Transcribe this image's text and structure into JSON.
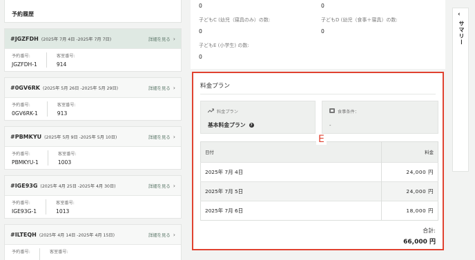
{
  "history": {
    "title": "予約履歴",
    "detail_label": "詳細を見る",
    "reservation_no_label": "予約番号:",
    "room_no_label": "客室番号:",
    "items": [
      {
        "code": "#JGZFDH",
        "dates": "(2025年 7月 4日 -2025年 7月 7日)",
        "reservation_no": "JGZFDH-1",
        "room_no": "914"
      },
      {
        "code": "#0GV6RK",
        "dates": "(2025年 5月 26日 -2025年 5月 29日)",
        "reservation_no": "0GV6RK-1",
        "room_no": "913"
      },
      {
        "code": "#PBMKYU",
        "dates": "(2025年 5月 9日 -2025年 5月 10日)",
        "reservation_no": "PBMKYU-1",
        "room_no": "1003"
      },
      {
        "code": "#IGE93G",
        "dates": "(2025年 4月 25日 -2025年 4月 30日)",
        "reservation_no": "IGE93G-1",
        "room_no": "1013"
      },
      {
        "code": "#ILTEQH",
        "dates": "(2025年 4月 14日 -2025年 4月 15日)",
        "reservation_no": "",
        "room_no": ""
      }
    ]
  },
  "counts": {
    "top_left_value": "0",
    "top_right_value": "0",
    "child_c_label": "子どもC (幼児（寝具のみ）の数:",
    "child_c_value": "0",
    "child_d_label": "子どもD (幼児（食事＋寝具）の数:",
    "child_d_value": "0",
    "child_e_label": "子どもE (小学生) の数:",
    "child_e_value": "0"
  },
  "plan": {
    "title": "料金プラン",
    "plan_label": "料金プラン",
    "plan_value": "基本料金プラン",
    "meal_label": "食事条件：",
    "meal_value": "-",
    "annotation": "E",
    "table": {
      "date_header": "日付",
      "price_header": "料金",
      "rows": [
        {
          "date": "2025年 7月 4日",
          "price": "24,000 円"
        },
        {
          "date": "2025年 7月 5日",
          "price": "24,000 円"
        },
        {
          "date": "2025年 7月 6日",
          "price": "18,000 円"
        }
      ]
    },
    "total_label": "合計:",
    "total_value": "66,000 円"
  },
  "summary": {
    "label": "サマリー"
  },
  "colors": {
    "highlight": "#e0412f",
    "active_card": "#dfe9e3"
  }
}
